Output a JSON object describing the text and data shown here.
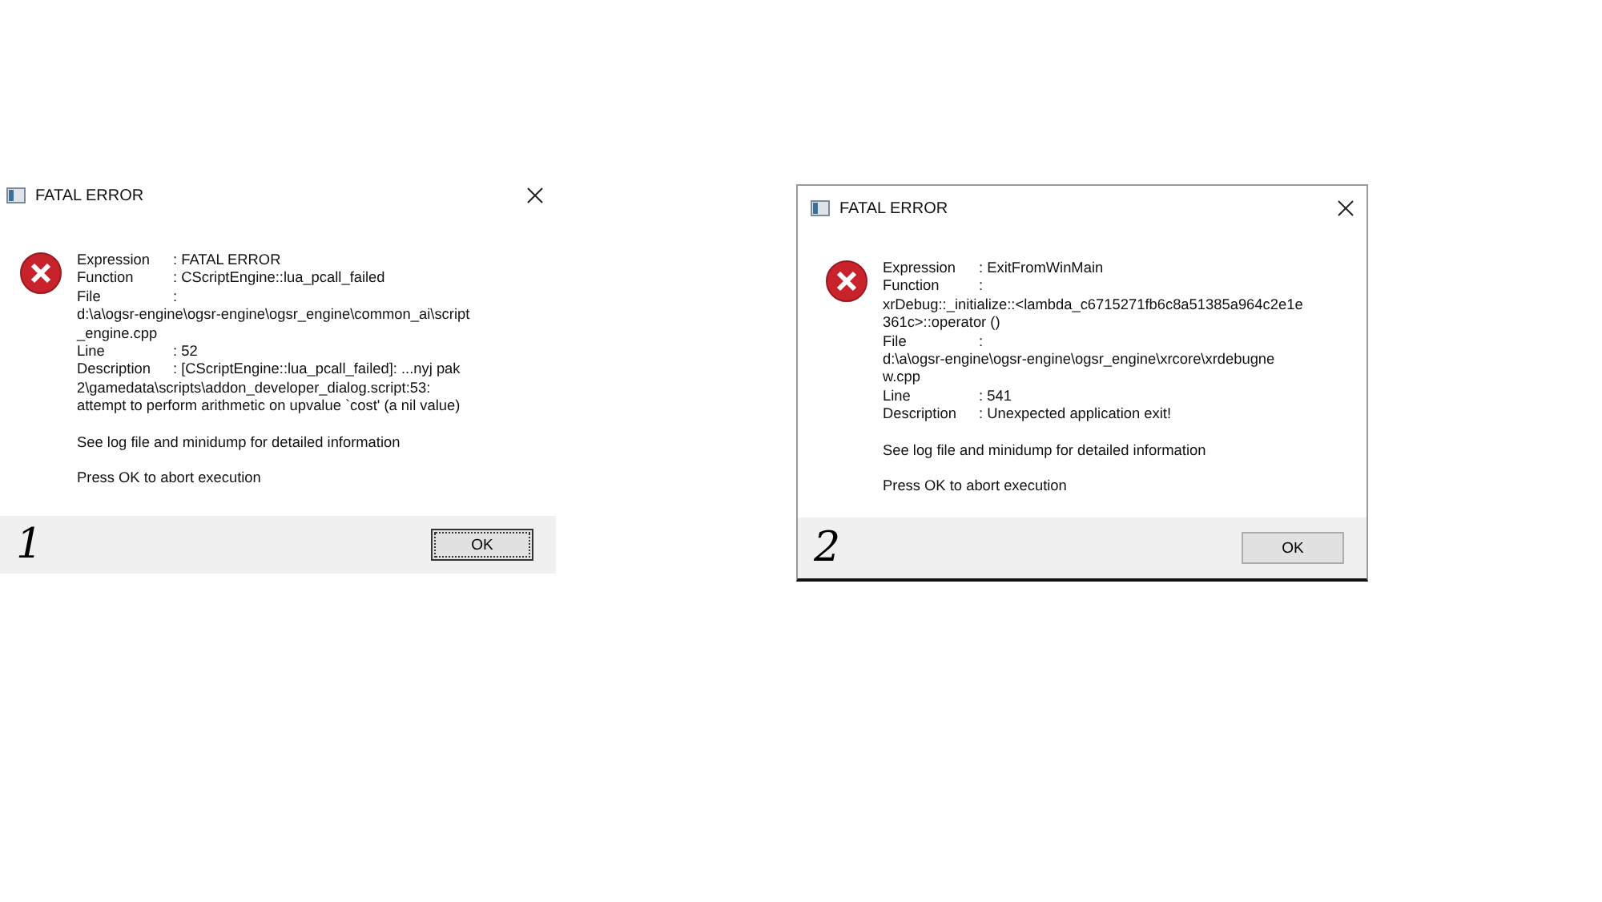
{
  "dialogs": [
    {
      "title": "FATAL ERROR",
      "fields": [
        {
          "label": "Expression",
          "value": ": FATAL ERROR"
        },
        {
          "label": "Function",
          "value": ": CScriptEngine::lua_pcall_failed"
        },
        {
          "label": "File",
          "value": ":",
          "continuation": [
            "d:\\a\\ogsr-engine\\ogsr-engine\\ogsr_engine\\common_ai\\script",
            "_engine.cpp"
          ]
        },
        {
          "label": "Line",
          "value": ": 52"
        },
        {
          "label": "Description",
          "value": ": [CScriptEngine::lua_pcall_failed]: ...nyj pak",
          "continuation": [
            "2\\gamedata\\scripts\\addon_developer_dialog.script:53:",
            "attempt to perform arithmetic on upvalue `cost' (a nil value)"
          ]
        }
      ],
      "notes": [
        "See log file and minidump for detailed information",
        "Press OK to abort execution"
      ],
      "button": {
        "label": "OK",
        "focused": true
      },
      "annotation": "1"
    },
    {
      "title": "FATAL ERROR",
      "fields": [
        {
          "label": "Expression",
          "value": ": ExitFromWinMain"
        },
        {
          "label": "Function",
          "value": ":",
          "continuation": [
            "xrDebug::_initialize::<lambda_c6715271fb6c8a51385a964c2e1e",
            "361c>::operator ()"
          ]
        },
        {
          "label": "File",
          "value": ":",
          "continuation": [
            "d:\\a\\ogsr-engine\\ogsr-engine\\ogsr_engine\\xrcore\\xrdebugne",
            "w.cpp"
          ]
        },
        {
          "label": "Line",
          "value": ": 541"
        },
        {
          "label": "Description",
          "value": ": Unexpected application exit!"
        }
      ],
      "notes": [
        "See log file and minidump for detailed information",
        "Press OK to abort execution"
      ],
      "button": {
        "label": "OK",
        "focused": false
      },
      "annotation": "2"
    }
  ]
}
